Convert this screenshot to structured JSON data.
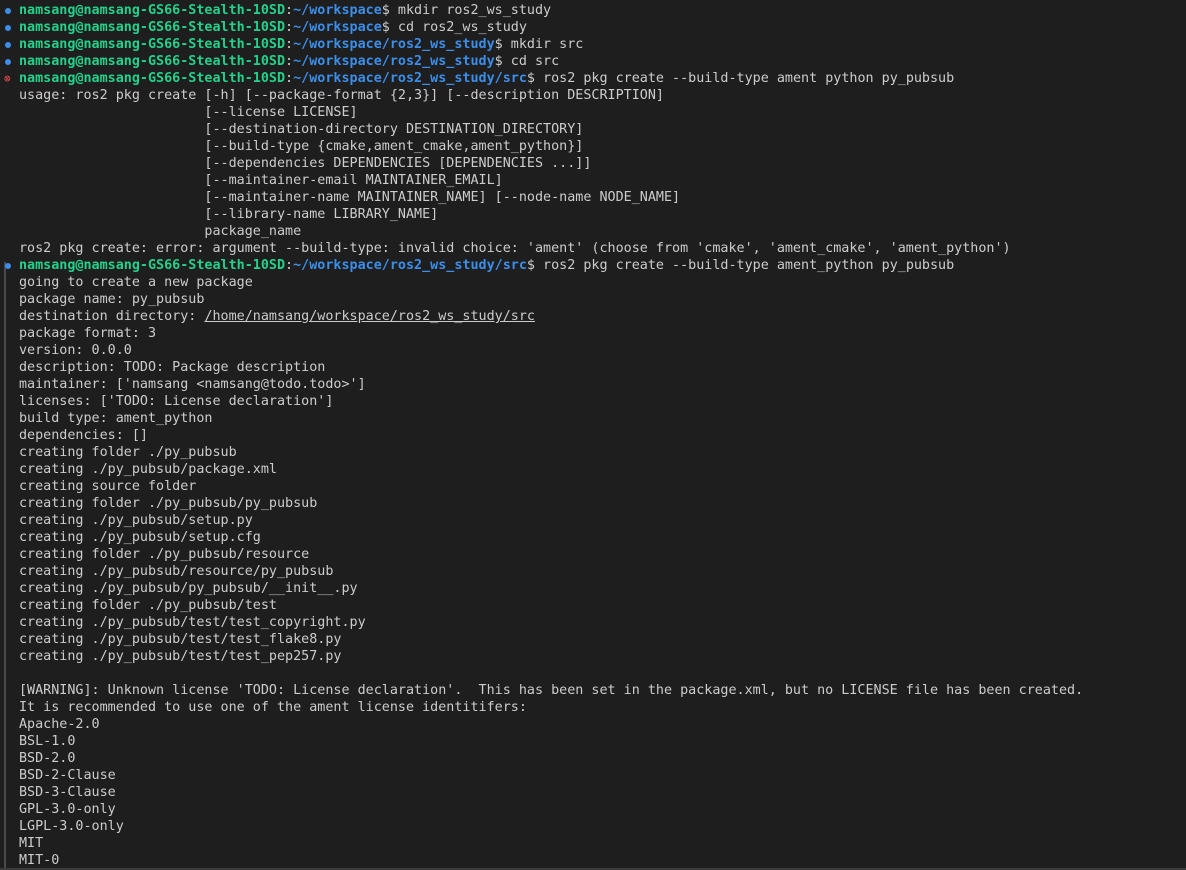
{
  "colors": {
    "background": "#1e1e1e",
    "text": "#cccccc",
    "user": "#23d18b",
    "path": "#3b8eea",
    "success_marker": "#3b8eea",
    "error_marker": "#f14c4c"
  },
  "prompt": {
    "user_host": "namsang@namsang-GS66-Stealth-10SD",
    "sep": ":"
  },
  "command_lines": [
    {
      "marker": "circle-success-icon",
      "path": "~/workspace",
      "cmd": "$ mkdir ros2_ws_study"
    },
    {
      "marker": "circle-success-icon",
      "path": "~/workspace",
      "cmd": "$ cd ros2_ws_study"
    },
    {
      "marker": "circle-success-icon",
      "path": "~/workspace/ros2_ws_study",
      "cmd": "$ mkdir src"
    },
    {
      "marker": "circle-success-icon",
      "path": "~/workspace/ros2_ws_study",
      "cmd": "$ cd src"
    },
    {
      "marker": "error-x-icon",
      "path": "~/workspace/ros2_ws_study/src",
      "cmd": "$ ros2 pkg create --build-type ament python py_pubsub"
    }
  ],
  "usage_lines": [
    "usage: ros2 pkg create [-h] [--package-format {2,3}] [--description DESCRIPTION]",
    "                       [--license LICENSE]",
    "                       [--destination-directory DESTINATION_DIRECTORY]",
    "                       [--build-type {cmake,ament_cmake,ament_python}]",
    "                       [--dependencies DEPENDENCIES [DEPENDENCIES ...]]",
    "                       [--maintainer-email MAINTAINER_EMAIL]",
    "                       [--maintainer-name MAINTAINER_NAME] [--node-name NODE_NAME]",
    "                       [--library-name LIBRARY_NAME]",
    "                       package_name",
    "ros2 pkg create: error: argument --build-type: invalid choice: 'ament' (choose from 'cmake', 'ament_cmake', 'ament_python')"
  ],
  "second_command": {
    "marker": "circle-success-icon",
    "path": "~/workspace/ros2_ws_study/src",
    "cmd": "$ ros2 pkg create --build-type ament_python py_pubsub"
  },
  "output_lines_before_link": [
    "going to create a new package",
    "package name: py_pubsub"
  ],
  "destination": {
    "label": "destination directory: ",
    "link": "/home/namsang/workspace/ros2_ws_study/src"
  },
  "output_lines": [
    "package format: 3",
    "version: 0.0.0",
    "description: TODO: Package description",
    "maintainer: ['namsang <namsang@todo.todo>']",
    "licenses: ['TODO: License declaration']",
    "build type: ament_python",
    "dependencies: []",
    "creating folder ./py_pubsub",
    "creating ./py_pubsub/package.xml",
    "creating source folder",
    "creating folder ./py_pubsub/py_pubsub",
    "creating ./py_pubsub/setup.py",
    "creating ./py_pubsub/setup.cfg",
    "creating folder ./py_pubsub/resource",
    "creating ./py_pubsub/resource/py_pubsub",
    "creating ./py_pubsub/py_pubsub/__init__.py",
    "creating folder ./py_pubsub/test",
    "creating ./py_pubsub/test/test_copyright.py",
    "creating ./py_pubsub/test/test_flake8.py",
    "creating ./py_pubsub/test/test_pep257.py",
    "",
    "[WARNING]: Unknown license 'TODO: License declaration'.  This has been set in the package.xml, but no LICENSE file has been created.",
    "It is recommended to use one of the ament license identitifers:",
    "Apache-2.0",
    "BSL-1.0",
    "BSD-2.0",
    "BSD-2-Clause",
    "BSD-3-Clause",
    "GPL-3.0-only",
    "LGPL-3.0-only",
    "MIT",
    "MIT-0"
  ]
}
